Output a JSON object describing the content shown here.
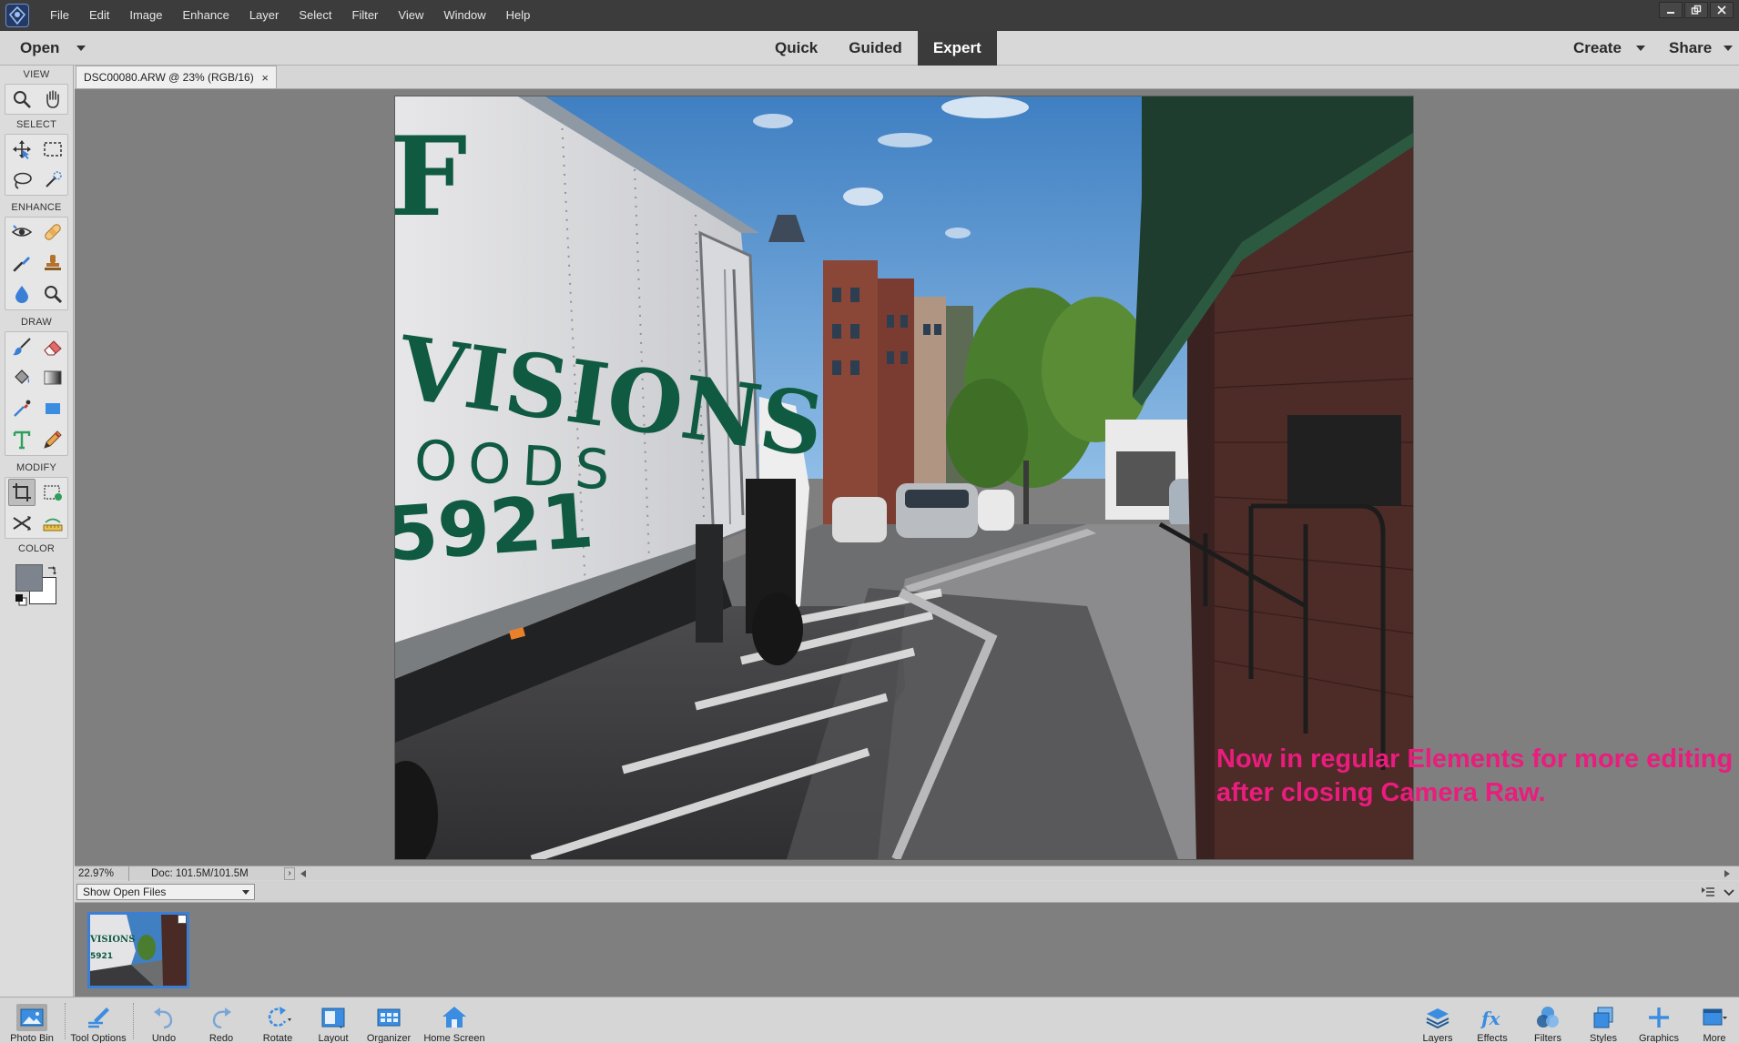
{
  "app": {
    "name": "Photoshop Elements",
    "menu": [
      "File",
      "Edit",
      "Image",
      "Enhance",
      "Layer",
      "Select",
      "Filter",
      "View",
      "Window",
      "Help"
    ]
  },
  "modebar": {
    "open_label": "Open",
    "tabs": [
      {
        "label": "Quick",
        "active": false
      },
      {
        "label": "Guided",
        "active": false
      },
      {
        "label": "Expert",
        "active": true
      }
    ],
    "create_label": "Create",
    "share_label": "Share"
  },
  "toolbox": {
    "sections": {
      "view": "VIEW",
      "select": "SELECT",
      "enhance": "ENHANCE",
      "draw": "DRAW",
      "modify": "MODIFY",
      "color": "COLOR"
    },
    "tools": [
      "zoom-tool",
      "hand-tool",
      "move-tool",
      "rectangular-marquee-tool",
      "lasso-tool",
      "quick-selection-tool",
      "red-eye-tool",
      "spot-healing-brush-tool",
      "smart-brush-tool",
      "clone-stamp-tool",
      "blur-tool",
      "sponge-tool",
      "brush-tool",
      "eraser-tool",
      "paint-bucket-tool",
      "gradient-tool",
      "eyedropper-tool",
      "rectangle-shape-tool",
      "type-tool",
      "pencil-tool",
      "crop-tool",
      "recompose-tool",
      "content-aware-move-tool",
      "straighten-tool"
    ],
    "selected_tool": "crop-tool",
    "foreground_color": "#7d848e",
    "background_color": "#ffffff"
  },
  "document": {
    "tab_label": "DSC00080.ARW @ 23% (RGB/16)",
    "close_glyph": "×",
    "annotation_line1": "Now in regular Elements for more editing",
    "annotation_line2": "after closing Camera Raw.",
    "annotation_color": "#ea1c7d",
    "photo_text": {
      "line_top": "F",
      "line_visions": "VISIONS",
      "line_goods": "OODS",
      "line_number": "5921"
    }
  },
  "status": {
    "zoom": "22.97%",
    "doc_size": "Doc: 101.5M/101.5M",
    "arrow": "›"
  },
  "photo_bin": {
    "dropdown_value": "Show Open Files",
    "thumb_text": {
      "visions": "VISIONS",
      "number": "5921"
    }
  },
  "taskbar": {
    "left": [
      {
        "label": "Photo Bin",
        "icon": "photo-bin-icon",
        "active": true
      },
      {
        "label": "Tool Options",
        "icon": "tool-options-icon",
        "active": false
      },
      {
        "label": "Undo",
        "icon": "undo-icon",
        "active": false
      },
      {
        "label": "Redo",
        "icon": "redo-icon",
        "active": false
      },
      {
        "label": "Rotate",
        "icon": "rotate-icon",
        "active": false
      },
      {
        "label": "Layout",
        "icon": "layout-icon",
        "active": false
      },
      {
        "label": "Organizer",
        "icon": "organizer-icon",
        "active": false
      },
      {
        "label": "Home Screen",
        "icon": "home-screen-icon",
        "active": false
      }
    ],
    "right": [
      {
        "label": "Layers",
        "icon": "layers-icon"
      },
      {
        "label": "Effects",
        "icon": "effects-icon"
      },
      {
        "label": "Filters",
        "icon": "filters-icon"
      },
      {
        "label": "Styles",
        "icon": "styles-icon"
      },
      {
        "label": "Graphics",
        "icon": "graphics-icon"
      },
      {
        "label": "More",
        "icon": "more-icon"
      }
    ]
  }
}
